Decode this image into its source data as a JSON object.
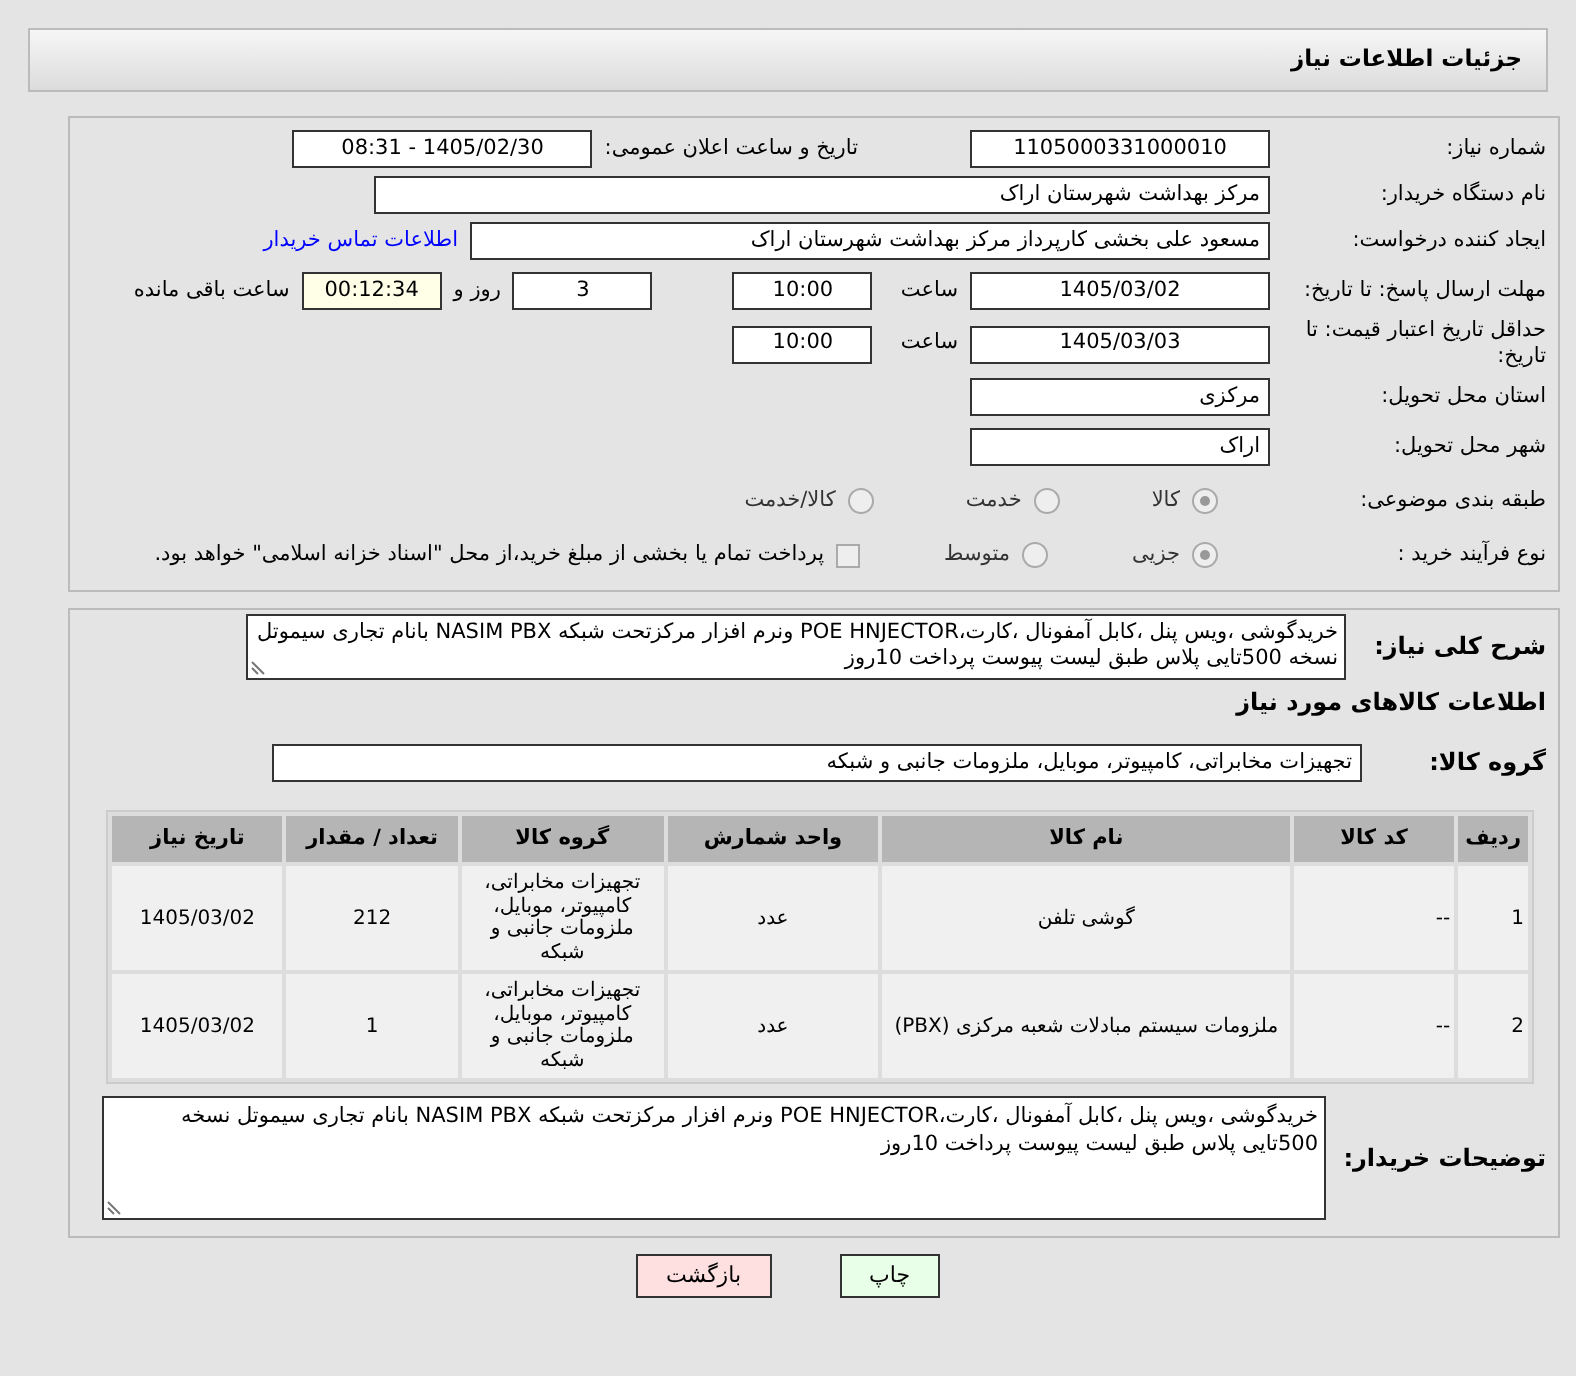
{
  "page_title": "جزئیات اطلاعات نیاز",
  "need_number": {
    "label": "شماره نیاز:",
    "value": "1105000331000010"
  },
  "announce": {
    "label": "تاریخ و ساعت اعلان عمومی:",
    "value": "1405/02/30 - 08:31"
  },
  "buyer_org": {
    "label": "نام دستگاه خریدار:",
    "value": "مرکز بهداشت شهرستان اراک"
  },
  "requester": {
    "label": "ایجاد کننده درخواست:",
    "value": "مسعود علی بخشی کارپرداز مرکز بهداشت شهرستان اراک",
    "link": "اطلاعات تماس خریدار"
  },
  "deadline": {
    "label": "مهلت ارسال پاسخ: تا تاریخ:",
    "date": "1405/03/02",
    "time_label": "ساعت",
    "time": "10:00",
    "days": "3",
    "days_label": "روز و",
    "remaining": "00:12:34",
    "remaining_label": "ساعت باقی مانده"
  },
  "validity": {
    "label": "حداقل تاریخ اعتبار قیمت: تا تاریخ:",
    "date": "1405/03/03",
    "time_label": "ساعت",
    "time": "10:00"
  },
  "province": {
    "label": "استان محل تحویل:",
    "value": "مرکزی"
  },
  "city": {
    "label": "شهر محل تحویل:",
    "value": "اراک"
  },
  "category": {
    "label": "طبقه بندی موضوعی:",
    "options": [
      {
        "label": "کالا",
        "selected": true
      },
      {
        "label": "خدمت",
        "selected": false
      },
      {
        "label": "کالا/خدمت",
        "selected": false
      }
    ]
  },
  "purchase_type": {
    "label": "نوع فرآیند خرید :",
    "options": [
      {
        "label": "جزیی",
        "selected": true
      },
      {
        "label": "متوسط",
        "selected": false
      }
    ],
    "treasury": {
      "label": "پرداخت تمام یا بخشی از مبلغ خرید،از محل \"اسناد خزانه اسلامی\" خواهد بود.",
      "checked": false
    }
  },
  "description": {
    "label": "شرح کلی نیاز:",
    "value": "خریدگوشی ،ویس پنل ،کابل آمفونال ،کارت،POE HNJECTOR ونرم افزار مرکزتحت شبکه NASIM PBX بانام تجاری سیموتل نسخه 500تایی پلاس  طبق لیست پیوست پرداخت 10روز"
  },
  "goods_heading": "اطلاعات کالاهای مورد نیاز",
  "goods_group": {
    "label": "گروه کالا:",
    "value": "تجهیزات مخابراتی، کامپیوتر، موبایل، ملزومات جانبی و شبکه"
  },
  "table": {
    "columns": [
      "ردیف",
      "کد کالا",
      "نام کالا",
      "واحد شمارش",
      "گروه کالا",
      "تعداد / مقدار",
      "تاریخ نیاز"
    ],
    "rows": [
      [
        "1",
        "--",
        "گوشی تلفن",
        "عدد",
        "تجهیزات مخابراتی، کامپیوتر، موبایل، ملزومات جانبی و شبکه",
        "212",
        "1405/03/02"
      ],
      [
        "2",
        "--",
        "ملزومات سیستم مبادلات شعبه مرکزی (PBX)",
        "عدد",
        "تجهیزات مخابراتی، کامپیوتر، موبایل، ملزومات جانبی و شبکه",
        "1",
        "1405/03/02"
      ]
    ]
  },
  "buyer_notes": {
    "label": "توضیحات خریدار:",
    "value": "خریدگوشی ،ویس پنل ،کابل آمفونال ،کارت،POE HNJECTOR ونرم افزار مرکزتحت شبکه NASIM PBX بانام تجاری سیموتل نسخه 500تایی پلاس  طبق لیست پیوست پرداخت 10روز"
  },
  "buttons": [
    {
      "label": "چاپ",
      "kind": "print"
    },
    {
      "label": "بازگشت",
      "kind": "back"
    }
  ]
}
